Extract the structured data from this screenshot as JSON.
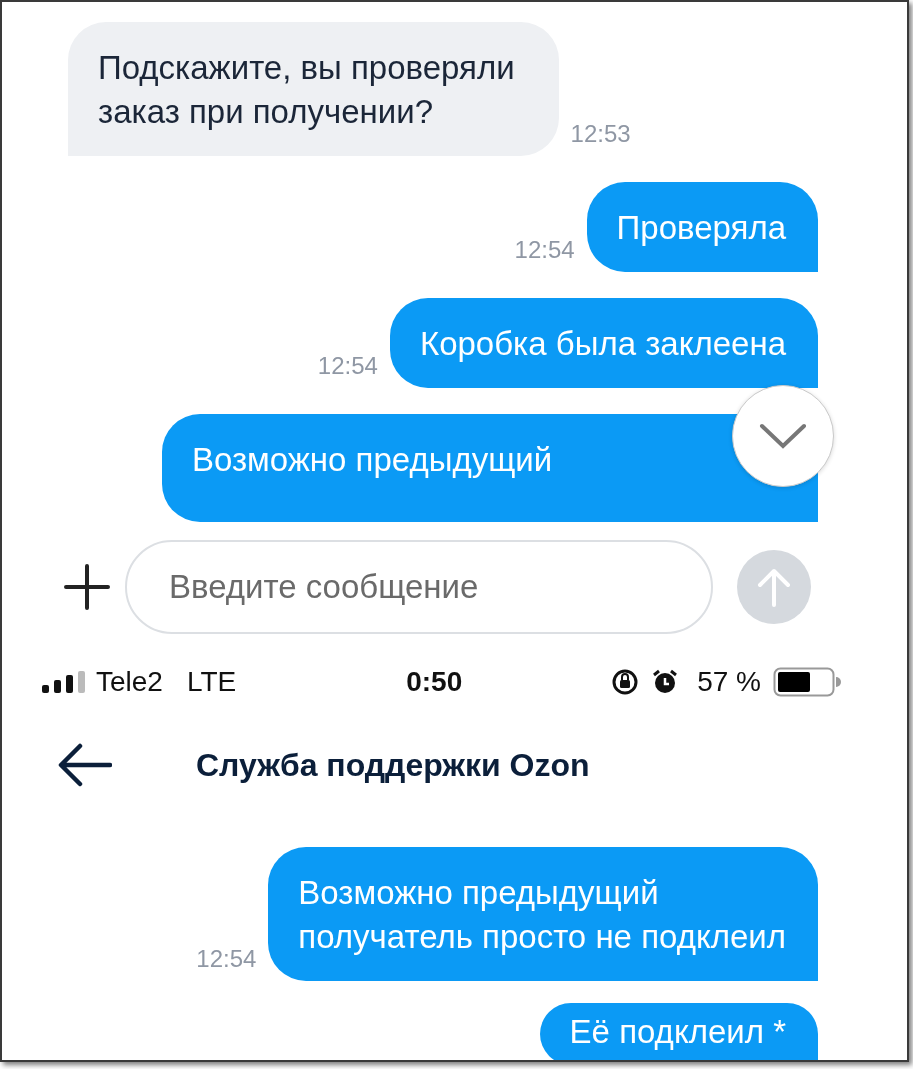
{
  "chat_top": {
    "messages": [
      {
        "kind": "in",
        "text": "Подскажите, вы проверяли\nзаказ при получении?",
        "time": "12:53"
      },
      {
        "kind": "out",
        "text": "Проверяла",
        "time": "12:54"
      },
      {
        "kind": "out",
        "text": "Коробка была заклеена",
        "time": "12:54"
      },
      {
        "kind": "out",
        "text": "Возможно предыдущий"
      }
    ]
  },
  "composer": {
    "placeholder": "Введите сообщение"
  },
  "status_bar": {
    "carrier": "Tele2",
    "network": "LTE",
    "time": "0:50",
    "battery": "57 %"
  },
  "header": {
    "title": "Служба поддержки Ozon"
  },
  "chat_bottom": {
    "messages": [
      {
        "kind": "out",
        "text": "Возможно предыдущий\nполучатель просто не подклеил",
        "time": "12:54"
      },
      {
        "kind": "out",
        "text": "Её подклеил *"
      }
    ]
  }
}
